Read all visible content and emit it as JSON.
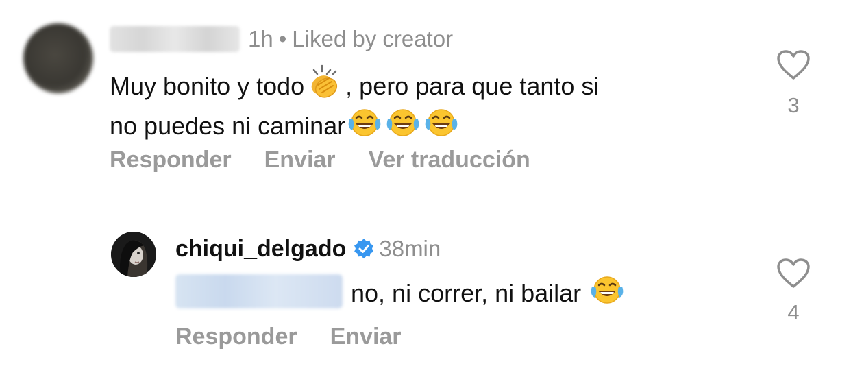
{
  "comment1": {
    "username": "",
    "time": "1h",
    "liked_label": "Liked by creator",
    "text_part1": "Muy bonito y todo",
    "text_part2": ", pero para que tanto si",
    "text_line2": "no puedes ni caminar",
    "emoji_clap": "clapping-hands-icon",
    "emoji_laugh": "face-with-tears-of-joy-icon",
    "actions": {
      "reply": "Responder",
      "send": "Enviar",
      "translate": "Ver traducción"
    },
    "like_count": "3"
  },
  "comment2": {
    "username": "chiqui_delgado",
    "verified": true,
    "time": "38min",
    "mention": "",
    "text": "no, ni correr, ni bailar",
    "actions": {
      "reply": "Responder",
      "send": "Enviar"
    },
    "like_count": "4"
  },
  "colors": {
    "meta_gray": "#8e8e8e",
    "action_gray": "#9a9a9a",
    "verified_blue": "#3897f0"
  }
}
